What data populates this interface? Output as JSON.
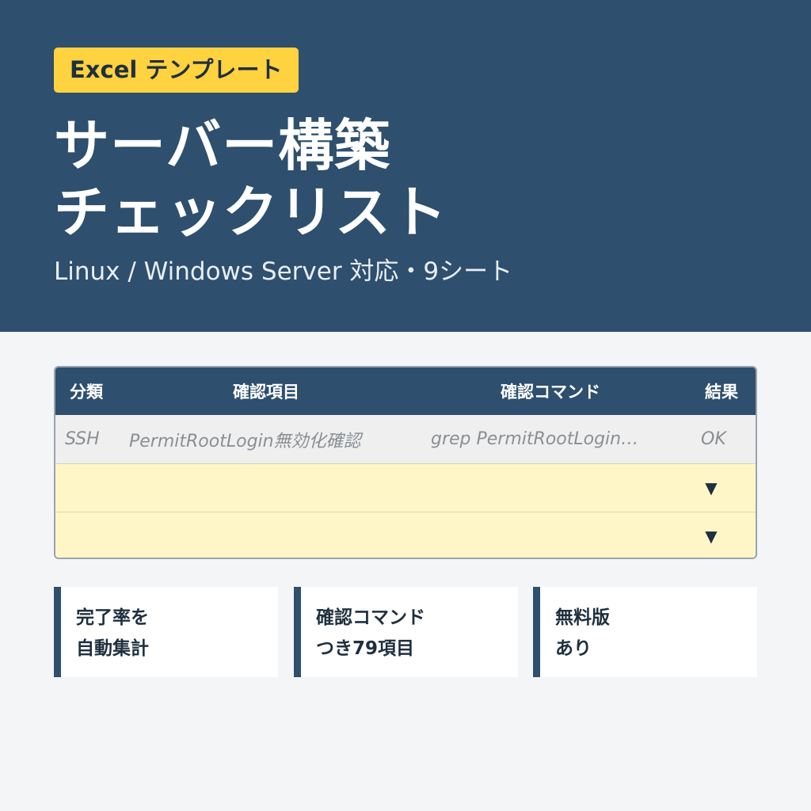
{
  "header": {
    "badge": "Excel テンプレート",
    "title_line1": "サーバー構築",
    "title_line2": "チェックリスト",
    "subtitle": "Linux / Windows Server 対応・9シート"
  },
  "table": {
    "columns": [
      "分類",
      "確認項目",
      "確認コマンド",
      "結果"
    ],
    "example_row": {
      "category": "SSH",
      "item": "PermitRootLogin無効化確認",
      "command": "grep PermitRootLogin…",
      "result": "OK"
    },
    "dropdown_icon": "▼"
  },
  "features": [
    {
      "line1": "完了率を",
      "line2": "自動集計"
    },
    {
      "line1": "確認コマンド",
      "line2": "つき79項目"
    },
    {
      "line1": "無料版",
      "line2": "あり"
    }
  ],
  "colors": {
    "primary": "#2e4f6e",
    "accent": "#ffd23f",
    "input_row": "#fff6c8",
    "background": "#f4f5f7"
  }
}
